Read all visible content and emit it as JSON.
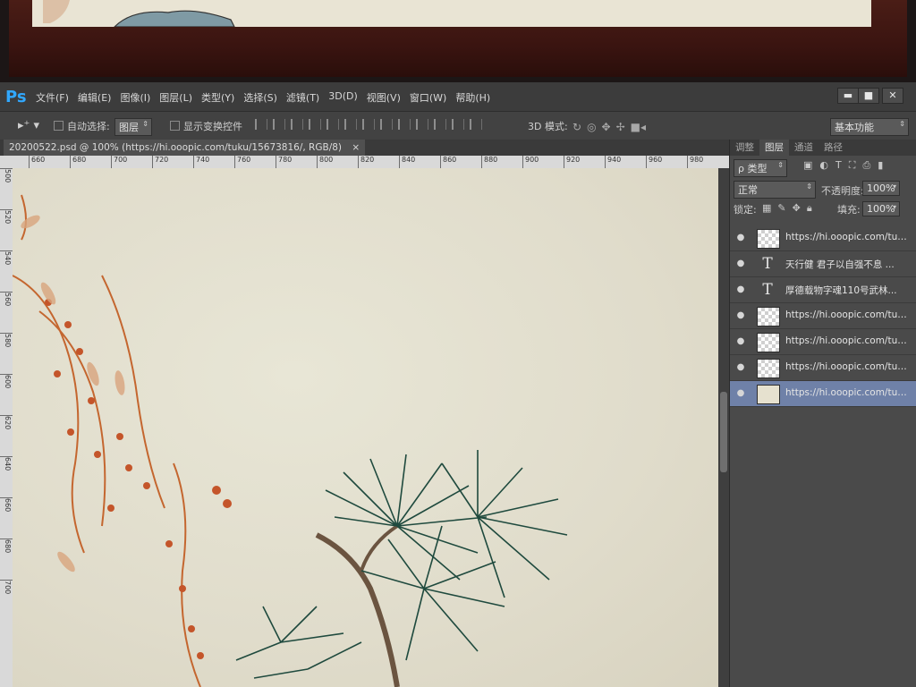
{
  "app": {
    "logo": "Ps"
  },
  "menu": [
    "文件(F)",
    "编辑(E)",
    "图像(I)",
    "图层(L)",
    "类型(Y)",
    "选择(S)",
    "滤镜(T)",
    "3D(D)",
    "视图(V)",
    "窗口(W)",
    "帮助(H)"
  ],
  "window_controls": {
    "minimize": "▬",
    "restore": "■",
    "close": "✕"
  },
  "options_bar": {
    "auto_select_label": "自动选择:",
    "auto_select_value": "图层",
    "show_transform_label": "显示变换控件",
    "mode_3d_label": "3D 模式:",
    "workspace_value": "基本功能"
  },
  "document_tab": {
    "title": "20200522.psd @ 100% (https://hi.ooopic.com/tuku/15673816/, RGB/8)",
    "close": "×"
  },
  "ruler": {
    "horizontal": [
      "660",
      "680",
      "700",
      "720",
      "740",
      "760",
      "780",
      "800",
      "820",
      "840",
      "860",
      "880",
      "900",
      "920",
      "940",
      "960",
      "980"
    ],
    "vertical": [
      "500",
      "520",
      "540",
      "560",
      "580",
      "600",
      "620",
      "640",
      "660",
      "680",
      "700"
    ]
  },
  "panel": {
    "tabs": [
      "调整",
      "图层",
      "通道",
      "路径"
    ],
    "active_tab": "图层",
    "filter_value": "ρ 类型",
    "blend_mode": "正常",
    "opacity_label": "不透明度:",
    "opacity_value": "100%",
    "lock_label": "锁定:",
    "fill_label": "填充:",
    "fill_value": "100%"
  },
  "layers": [
    {
      "name": "https://hi.ooopic.com/tuku...",
      "kind": "image",
      "selected": false
    },
    {
      "name": "天行健 君子以自强不息 ...",
      "kind": "text",
      "selected": false
    },
    {
      "name": "厚德载物字魂110号武林...",
      "kind": "text",
      "selected": false
    },
    {
      "name": "https://hi.ooopic.com/tuku...",
      "kind": "image",
      "selected": false
    },
    {
      "name": "https://hi.ooopic.com/tuku...",
      "kind": "image",
      "selected": false
    },
    {
      "name": "https://hi.ooopic.com/tuku...",
      "kind": "image",
      "selected": false
    },
    {
      "name": "https://hi.ooopic.com/tuku...",
      "kind": "image",
      "selected": true
    }
  ],
  "icons": {
    "eye": "eye-icon",
    "text_layer": "T"
  },
  "colors": {
    "ps_blue": "#31a8ff",
    "selected_layer": "#6f81a8",
    "canvas_paper": "#e4e1d1",
    "pine": "#1f4a3e",
    "wisteria": "#c55a2e"
  }
}
